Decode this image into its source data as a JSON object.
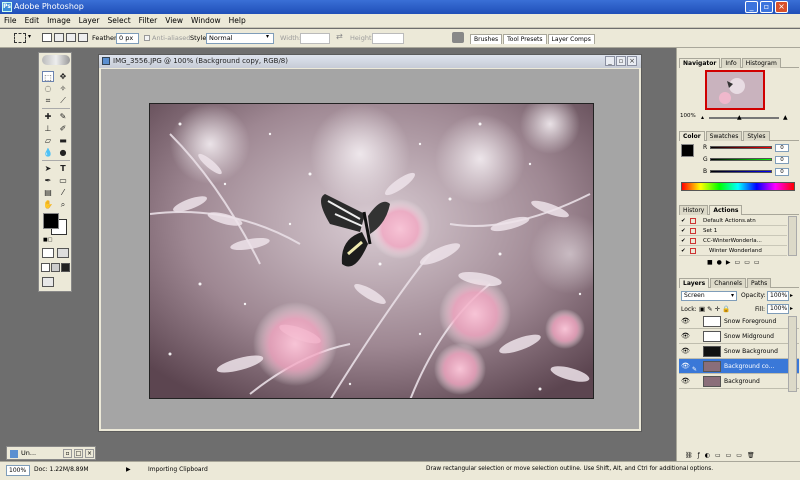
{
  "window": {
    "title": "Adobe Photoshop",
    "app_icon": "Ps"
  },
  "menu": [
    "File",
    "Edit",
    "Image",
    "Layer",
    "Select",
    "Filter",
    "View",
    "Window",
    "Help"
  ],
  "options": {
    "feather_label": "Feather:",
    "feather_value": "0 px",
    "antialiased": "Anti-aliased",
    "style_label": "Style:",
    "style_value": "Normal",
    "width_label": "Width:",
    "height_label": "Height:",
    "palette_tabs": [
      "Brushes",
      "Tool Presets",
      "Layer Comps"
    ]
  },
  "document": {
    "title": "IMG_3556.JPG @ 100% (Background copy, RGB/8)"
  },
  "minimized_doc": "Un...",
  "navigator": {
    "tabs": [
      "Navigator",
      "Info",
      "Histogram"
    ],
    "zoom": "100%"
  },
  "color": {
    "tabs": [
      "Color",
      "Swatches",
      "Styles"
    ],
    "channels": [
      {
        "label": "R",
        "value": "0",
        "color": "#d00000"
      },
      {
        "label": "G",
        "value": "0",
        "color": "#00a000"
      },
      {
        "label": "B",
        "value": "0",
        "color": "#0000d0"
      }
    ]
  },
  "history": {
    "tabs": [
      "History",
      "Actions"
    ],
    "rows": [
      "Default Actions.atn",
      "Set 1",
      "CC-WinterWonderla...",
      "Winter Wonderland"
    ]
  },
  "layers": {
    "tabs": [
      "Layers",
      "Channels",
      "Paths"
    ],
    "blend_mode": "Screen",
    "opacity_label": "Opacity:",
    "opacity_value": "100%",
    "lock_label": "Lock:",
    "fill_label": "Fill:",
    "fill_value": "100%",
    "rows": [
      {
        "name": "Snow Foreground",
        "thumb": "#ffffff",
        "active": false
      },
      {
        "name": "Snow Midground",
        "thumb": "#ffffff",
        "active": false
      },
      {
        "name": "Snow Background",
        "thumb": "#111111",
        "active": false
      },
      {
        "name": "Background co...",
        "thumb": "#8a6e7a",
        "active": true
      },
      {
        "name": "Background",
        "thumb": "#8a6e7a",
        "active": false
      }
    ]
  },
  "status": {
    "zoom": "100%",
    "doc": "Doc: 1.22M/8.89M",
    "task": "Importing Clipboard",
    "hint": "Draw rectangular selection or move selection outline.  Use Shift, Alt, and Ctrl for additional options."
  }
}
